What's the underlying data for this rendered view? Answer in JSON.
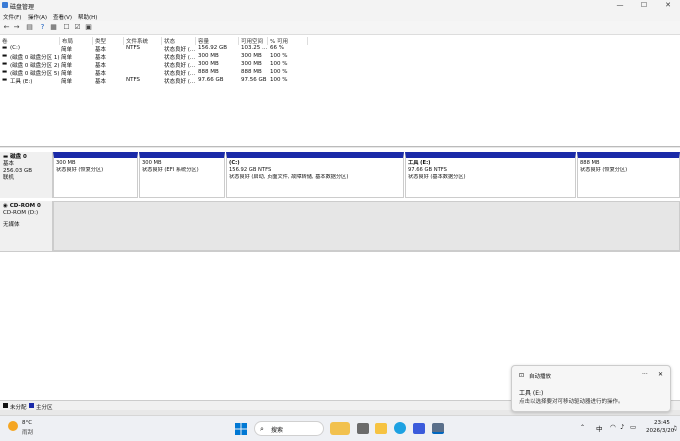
{
  "window": {
    "title": "磁盘管理",
    "minimize": "—",
    "maximize": "☐",
    "close": "✕"
  },
  "menu": [
    "文件(F)",
    "操作(A)",
    "查看(V)",
    "帮助(H)"
  ],
  "columns": [
    "卷",
    "布局",
    "类型",
    "文件系统",
    "状态",
    "容量",
    "可用空间",
    "% 可用"
  ],
  "volumes": [
    [
      "(C:)",
      "简单",
      "基本",
      "NTFS",
      "状态良好 (...",
      "156.92 GB",
      "103.25 ...",
      "66 %"
    ],
    [
      "(磁盘 0 磁盘分区 1)",
      "简单",
      "基本",
      "",
      "状态良好 (...",
      "300 MB",
      "300 MB",
      "100 %"
    ],
    [
      "(磁盘 0 磁盘分区 2)",
      "简单",
      "基本",
      "",
      "状态良好 (...",
      "300 MB",
      "300 MB",
      "100 %"
    ],
    [
      "(磁盘 0 磁盘分区 5)",
      "简单",
      "基本",
      "",
      "状态良好 (...",
      "888 MB",
      "888 MB",
      "100 %"
    ],
    [
      "工具 (E:)",
      "简单",
      "基本",
      "NTFS",
      "状态良好 (...",
      "97.66 GB",
      "97.56 GB",
      "100 %"
    ]
  ],
  "disk0": {
    "name": "磁盘 0",
    "type": "基本",
    "size": "256.03 GB",
    "status": "联机"
  },
  "partitions": [
    {
      "title": "",
      "size": "300 MB",
      "status": "状态良好 (恢复分区)"
    },
    {
      "title": "",
      "size": "300 MB",
      "status": "状态良好 (EFI 系统分区)"
    },
    {
      "title": "(C:)",
      "size": "156.92 GB NTFS",
      "status": "状态良好 (启动, 页面文件, 故障转储, 基本数据分区)"
    },
    {
      "title": "工具 (E:)",
      "size": "97.66 GB NTFS",
      "status": "状态良好 (基本数据分区)"
    },
    {
      "title": "",
      "size": "888 MB",
      "status": "状态良好 (恢复分区)"
    }
  ],
  "cdrom": {
    "name": "CD-ROM 0",
    "type": "CD-ROM (D:)",
    "status": "无媒体"
  },
  "legend": {
    "unalloc": "未分配",
    "primary": "主分区"
  },
  "toast": {
    "app": "自动播放",
    "title": "工具 (E:)",
    "body": "点击以选择要对可移动驱动器进行的操作。",
    "more": "···",
    "close": "✕"
  },
  "taskbar": {
    "weather_temp": "8°C",
    "weather_desc": "雨刮",
    "search": "搜索",
    "ime": "中",
    "time": "23:45",
    "date": "2026/3/20"
  },
  "colors": {
    "partition": "#1a2aa8",
    "accent": "#0067c0"
  }
}
